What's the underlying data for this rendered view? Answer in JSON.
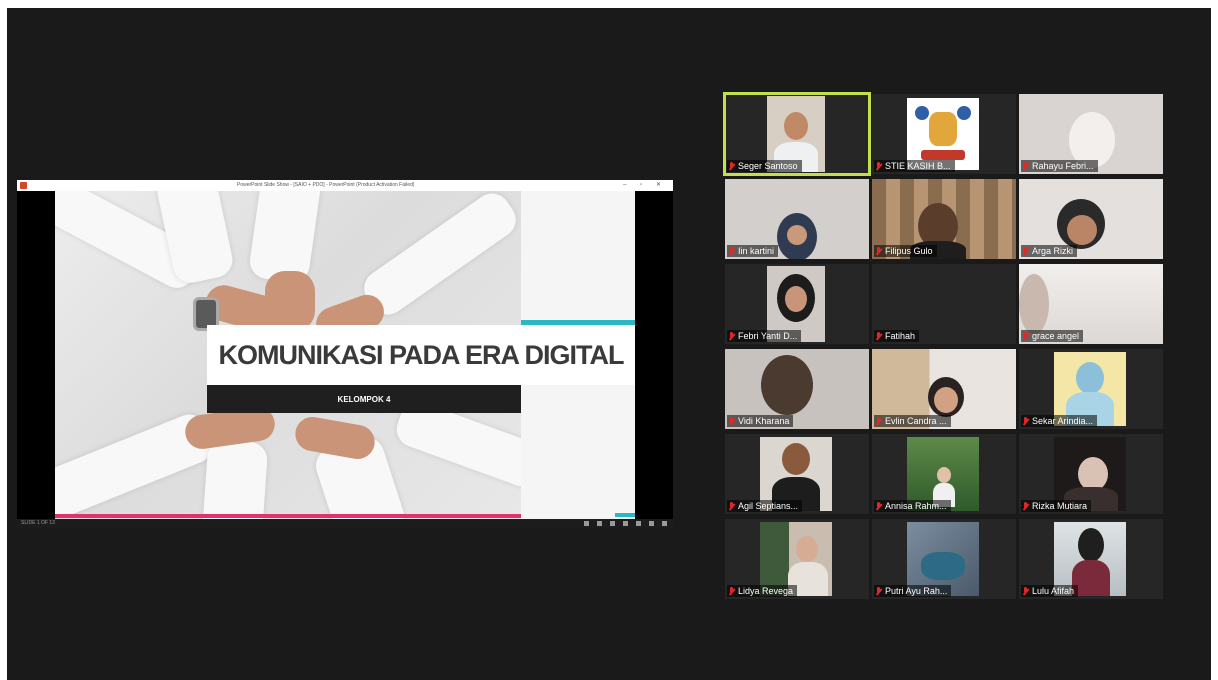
{
  "share": {
    "titlebar": "PowerPoint Slide Show - [SAIO + PDO] - PowerPoint (Product Activation Failed)",
    "controls": "– ▫ ✕",
    "slide_title": "KOMUNIKASI PADA ERA DIGITAL",
    "slide_subtitle": "KELOMPOK 4",
    "status_left": "SLIDE 1 OF 13"
  },
  "participants": [
    {
      "name": "Seger Santoso",
      "muted": true,
      "active": true
    },
    {
      "name": "STIE KASIH B...",
      "muted": true
    },
    {
      "name": "Rahayu Febri...",
      "muted": true
    },
    {
      "name": "Iin kartini",
      "muted": true
    },
    {
      "name": "Filipus Gulo",
      "muted": true
    },
    {
      "name": "Arga Rizki",
      "muted": true
    },
    {
      "name": "Febri Yanti D...",
      "muted": true
    },
    {
      "name": "Fatihah",
      "muted": true
    },
    {
      "name": "grace angel",
      "muted": true
    },
    {
      "name": "Vidi Kharana",
      "muted": true
    },
    {
      "name": "Evlin Candra ...",
      "muted": true
    },
    {
      "name": "Sekar Arindia...",
      "muted": true
    },
    {
      "name": "Agil Septians...",
      "muted": true
    },
    {
      "name": "Annisa Rahm...",
      "muted": true
    },
    {
      "name": "Rizka Mutiara",
      "muted": true
    },
    {
      "name": "Lidya Revega",
      "muted": true
    },
    {
      "name": "Putri Ayu Rah...",
      "muted": true
    },
    {
      "name": "Lulu Afifah",
      "muted": true
    }
  ],
  "colors": {
    "background": "#1a1a1a",
    "active_speaker": "#c1e04a",
    "muted_icon": "#e02828",
    "slide_accent_teal": "#2ab8c8",
    "slide_accent_pink": "#e0336b"
  },
  "icons": {
    "muted": "mic-muted-icon",
    "app": "powerpoint-icon"
  }
}
